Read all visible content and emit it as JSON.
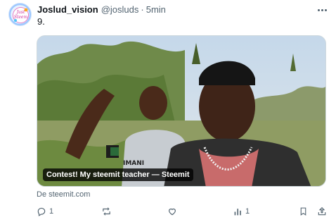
{
  "post": {
    "author_name": "Joslud_vision",
    "author_handle": "@josluds",
    "separator": "·",
    "time": "5min",
    "text": "9."
  },
  "avatar": {
    "lettering": "Just Steem"
  },
  "card": {
    "title": "Contest! My steemit teacher — Steemit",
    "source": "De steemit.com",
    "shirt_text": "IMANI"
  },
  "actions": {
    "reply_count": "1",
    "repost_count": "",
    "like_count": "",
    "views_count": "1"
  },
  "colors": {
    "text_primary": "#0f1419",
    "text_secondary": "#536471",
    "border": "#cfd9de"
  },
  "icons": [
    "reply-icon",
    "repost-icon",
    "like-icon",
    "views-icon",
    "bookmark-icon",
    "share-icon",
    "more-icon"
  ]
}
